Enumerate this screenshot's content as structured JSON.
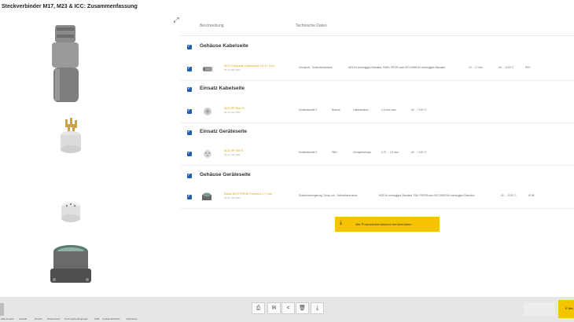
{
  "window": {
    "title": "Steckverbinder M17, M23 & ICC: Zusammenfassung"
  },
  "left_panel": {
    "images": [
      {
        "icon": "cable-gland-housing-image"
      },
      {
        "icon": "pin-insert-image"
      },
      {
        "icon": "socket-insert-image"
      },
      {
        "icon": "device-housing-image"
      }
    ],
    "expand_icon": "expand-icon"
  },
  "tabs": [
    {
      "label": "Beschreibung"
    },
    {
      "label": "Technische Daten"
    }
  ],
  "sections": [
    {
      "title": "Gehäuse Kabelseite",
      "product": {
        "name": "M23 Crimpnik Kabeldose 13-17 mm",
        "number": "66.22.200.0000",
        "specs": [
          "Crimplock - Schnellverschluss",
          "M23 für vorrangiges Standard, PA66 / PBT/B nach ISO 20653 für vorrangiges Standard",
          "13 ... 17 mm",
          "-40 ... +125 °C",
          "IP67"
        ]
      }
    },
    {
      "title": "Einsatz Kabelseite",
      "product": {
        "name": "M23 9P Buc S",
        "number": "66.23.200.0002",
        "specs": [
          "Kontaktanzahl 9",
          "Buchse",
          "Löttanschluss",
          "1,5 mm² max.",
          "-40 ... +125 °C"
        ]
      }
    },
    {
      "title": "Einsatz Geräteseite",
      "product": {
        "name": "M23 9P Stif S",
        "number": "66.23.100.0002",
        "specs": [
          "Kontaktanzahl 9",
          "PBN",
          "Crimpanschluss",
          "0,72 ... 1,6 mm²",
          "-40 ... +125 °C"
        ]
      }
    },
    {
      "title": "Gehäuse Geräteseite",
      "product": {
        "name": "Basis M23 PRMS Fixmont 2,7 mm",
        "number": "66.21.100.0001",
        "specs": [
          "Schraubverriegelung, Crimp-Lok - Schnellverschluss",
          "M23 für vorrangiges Standard, PA6 / PBT/B nach ISO 20653 für vorrangiges Standard",
          "-40 ... +125 °C",
          "IP 68"
        ]
      }
    }
  ],
  "download_button": {
    "label": "Alle Produktinformationen herunterladen",
    "icon": "download-icon"
  },
  "toolbar": [
    {
      "icon": "print-icon",
      "glyph": "⎙"
    },
    {
      "icon": "envelope-icon",
      "glyph": "✉"
    },
    {
      "icon": "share-icon",
      "glyph": "<"
    },
    {
      "icon": "trash-icon",
      "glyph": "🗑"
    },
    {
      "icon": "download-icon",
      "glyph": "⤓"
    }
  ],
  "footer_buttons": {
    "next_label": "E-Ma"
  },
  "footer_links": [
    "Hilfe Ansehe",
    "Kontakt",
    "Drucke",
    "Datenschutz",
    "Nutzungsbedingungen",
    "AGB",
    "Cookie-Richtlinie",
    "Impressum"
  ],
  "colors": {
    "accent": "#f5c400",
    "checkbox": "#1e5fb4",
    "product_link": "#e8a500"
  }
}
